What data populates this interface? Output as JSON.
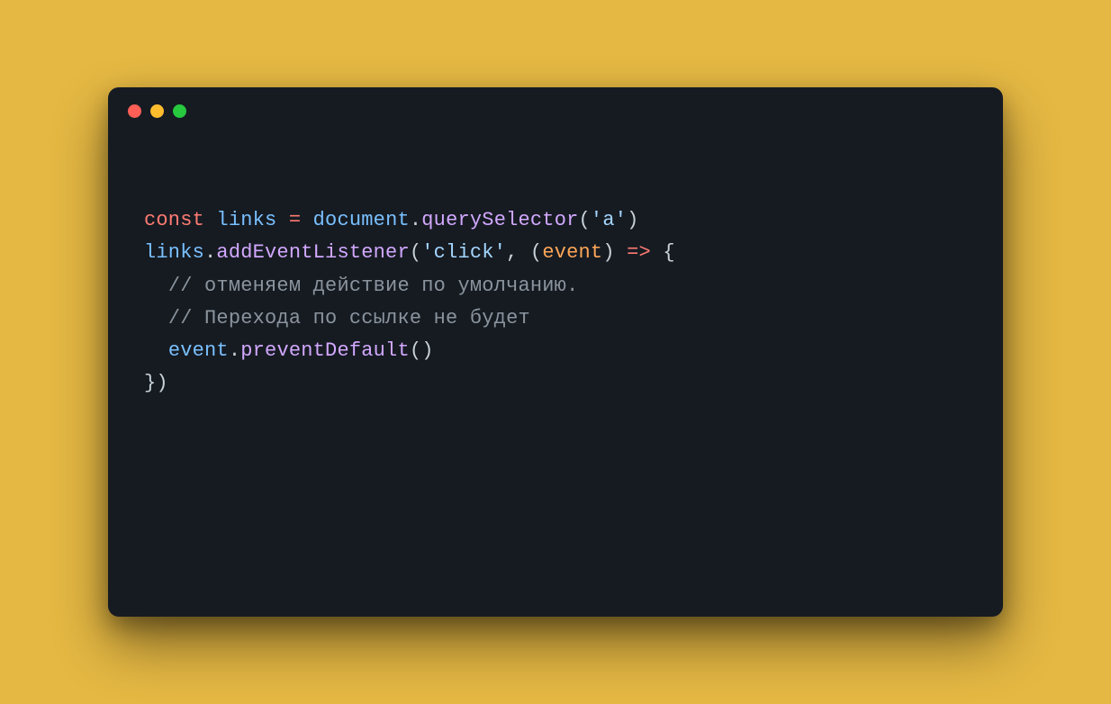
{
  "colors": {
    "background": "#e5b843",
    "editor_bg": "#161b22",
    "traffic_red": "#ff5f56",
    "traffic_yellow": "#ffbd2e",
    "traffic_green": "#27c93f"
  },
  "code": {
    "line1": {
      "keyword": "const",
      "sp1": " ",
      "identifier": "links",
      "sp2": " ",
      "operator": "=",
      "sp3": " ",
      "object": "document",
      "dot": ".",
      "method": "querySelector",
      "paren_open": "(",
      "string": "'a'",
      "paren_close": ")"
    },
    "line2": "",
    "line3": {
      "object": "links",
      "dot": ".",
      "method": "addEventListener",
      "paren_open": "(",
      "string": "'click'",
      "comma": ", ",
      "param_open": "(",
      "param": "event",
      "param_close": ")",
      "sp1": " ",
      "arrow": "=>",
      "sp2": " ",
      "brace_open": "{"
    },
    "line4": {
      "indent": "  ",
      "comment": "// отменяем действие по умолчанию."
    },
    "line5": {
      "indent": "  ",
      "comment": "// Перехода по ссылке не будет"
    },
    "line6": {
      "indent": "  ",
      "object": "event",
      "dot": ".",
      "method": "preventDefault",
      "parens": "()"
    },
    "line7": {
      "close": "})"
    }
  }
}
